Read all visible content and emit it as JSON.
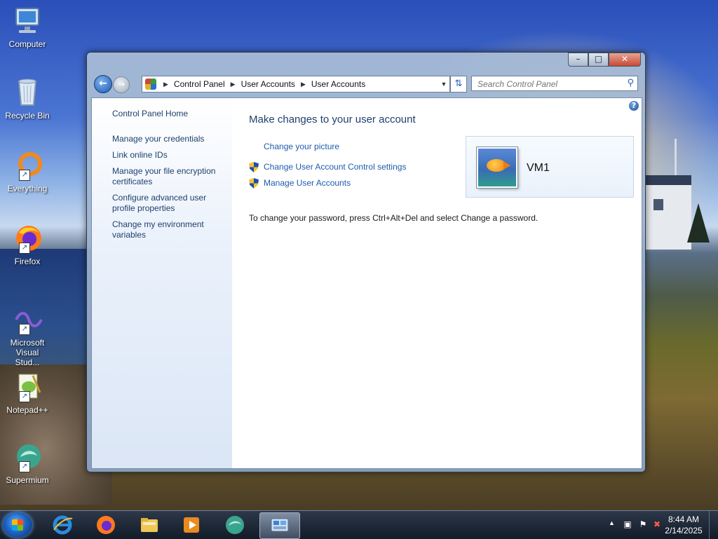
{
  "desktop": {
    "icons": [
      {
        "label": "Computer"
      },
      {
        "label": "Recycle Bin"
      },
      {
        "label": "Everything"
      },
      {
        "label": "Firefox"
      },
      {
        "label": "Microsoft Visual Stud..."
      },
      {
        "label": "Notepad++"
      },
      {
        "label": "Supermium"
      }
    ]
  },
  "window": {
    "controls": {
      "minimize": "–",
      "maximize": "□",
      "close": "✕"
    },
    "address": {
      "crumbs": [
        "Control Panel",
        "User Accounts",
        "User Accounts"
      ],
      "separator": "▶",
      "dropdown": "▼"
    },
    "search": {
      "placeholder": "Search Control Panel"
    },
    "sidebar": {
      "items": [
        {
          "label": "Control Panel Home"
        },
        {
          "label": "Manage your credentials"
        },
        {
          "label": "Link online IDs"
        },
        {
          "label": "Manage your file encryption certificates"
        },
        {
          "label": "Configure advanced user profile properties"
        },
        {
          "label": "Change my environment variables"
        }
      ]
    },
    "main": {
      "title": "Make changes to your user account",
      "tasks": [
        {
          "label": "Change your picture"
        },
        {
          "label": "Change User Account Control settings"
        },
        {
          "label": "Manage User Accounts"
        }
      ],
      "note": "To change your password, press Ctrl+Alt+Del and select Change a password.",
      "user": {
        "name": "VM1"
      },
      "help": "?"
    }
  },
  "taskbar": {
    "apps": [
      "internet-explorer",
      "firefox",
      "file-explorer",
      "media-player",
      "supermium",
      "control-panel"
    ],
    "clock": {
      "time": "8:44 AM",
      "date": "2/14/2025"
    }
  }
}
